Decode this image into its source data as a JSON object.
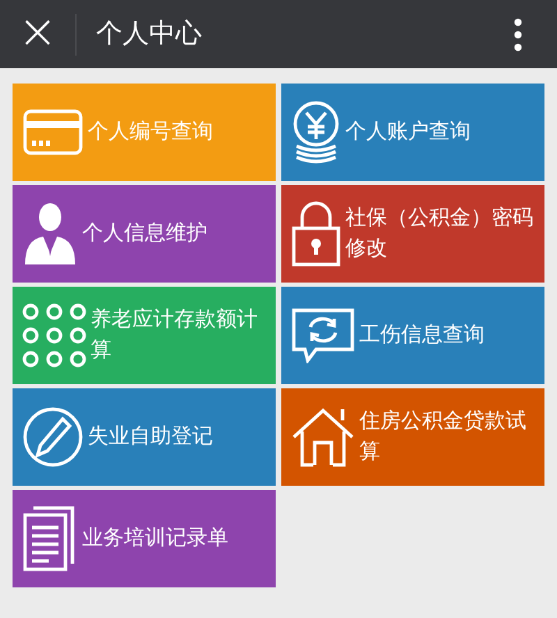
{
  "header": {
    "close": "×",
    "title": "个人中心"
  },
  "tiles": [
    {
      "label": "个人编号查询",
      "color": "#f39c12"
    },
    {
      "label": "个人账户查询",
      "color": "#2980b9"
    },
    {
      "label": "个人信息维护",
      "color": "#8e44ad"
    },
    {
      "label": "社保（公积金）密码修改",
      "color": "#c0392b"
    },
    {
      "label": "养老应计存款额计算",
      "color": "#27ae60"
    },
    {
      "label": "工伤信息查询",
      "color": "#2980b9"
    },
    {
      "label": "失业自助登记",
      "color": "#2980b9"
    },
    {
      "label": "住房公积金贷款试算",
      "color": "#d35400"
    },
    {
      "label": "业务培训记录单",
      "color": "#8e44ad"
    }
  ]
}
